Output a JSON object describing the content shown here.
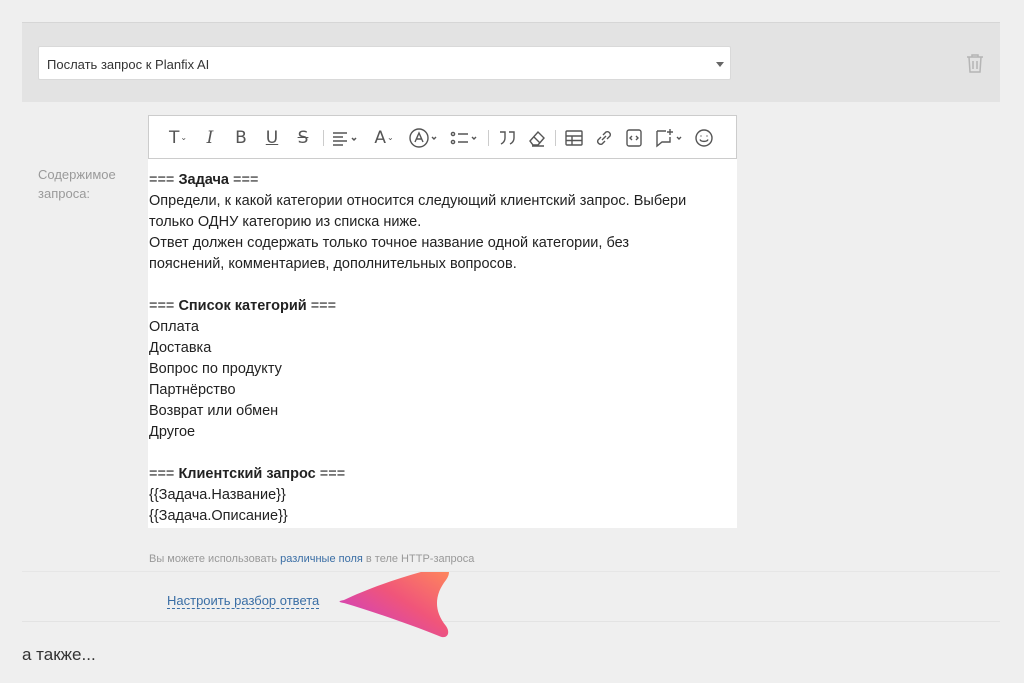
{
  "action": {
    "selected": "Послать запрос к Planfix AI",
    "icons": {
      "dropdown": "caret-down-icon",
      "delete": "trash-icon"
    }
  },
  "field": {
    "label": "Содержимое запроса:"
  },
  "toolbar": {
    "buttons": [
      "text-style-icon",
      "italic-icon",
      "bold-icon",
      "underline-icon",
      "strikethrough-icon",
      "align-icon",
      "font-color-icon",
      "background-color-icon",
      "list-icon",
      "quote-icon",
      "clear-format-icon",
      "table-icon",
      "link-icon",
      "code-icon",
      "insert-icon",
      "emoji-icon"
    ]
  },
  "content": {
    "h1_pre": "=== ",
    "h1": "Задача",
    "h1_post": " ===",
    "line1": "Определи, к какой категории относится следующий клиентский запрос. Выбери",
    "line2": "только ОДНУ категорию из списка ниже.",
    "line3": "Ответ должен содержать только точное название одной категории, без",
    "line4": "пояснений, комментариев, дополнительных вопросов.",
    "h2_pre": "=== ",
    "h2": "Список категорий",
    "h2_post": " ===",
    "cat1": "Оплата",
    "cat2": "Доставка",
    "cat3": "Вопрос по продукту",
    "cat4": "Партнёрство",
    "cat5": "Возврат или обмен",
    "cat6": "Другое",
    "h3_pre": "=== ",
    "h3": "Клиентский запрос",
    "h3_post": " ===",
    "var1": "{{Задача.Название}}",
    "var2": "{{Задача.Описание}}"
  },
  "hint": {
    "before": "Вы можете использовать ",
    "link": "различные поля",
    "after": " в теле HTTP-запроса"
  },
  "footer": {
    "link": "Настроить разбор ответа"
  },
  "also": "а также..."
}
